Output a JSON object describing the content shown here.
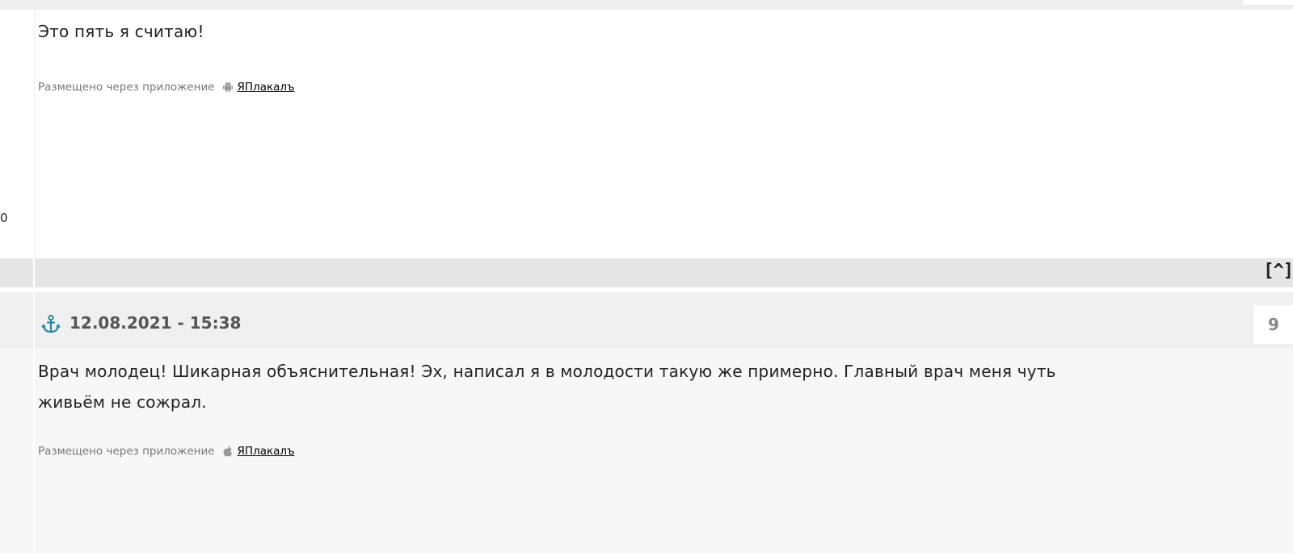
{
  "post1": {
    "message": "Это пять я считаю!",
    "posted_via_text": "Размещено через приложение",
    "platform_icon": "android-icon",
    "app_link": "ЯПлакалъ",
    "rating": "0"
  },
  "separator": {
    "up_link": "[^]"
  },
  "post2": {
    "anchor_icon": "anchor-icon",
    "date": "12.08.2021 - 15:38",
    "number": "9",
    "message_line1": "Врач молодец! Шикарная объяснительная! Эх, написал я в молодости такую же примерно. Главный врач меня чуть",
    "message_line2": "живьём не сожрал.",
    "posted_via_text": "Размещено через приложение",
    "platform_icon": "apple-icon",
    "app_link": "ЯПлакалъ"
  },
  "colors": {
    "anchor": "#2a8aa0",
    "separator_bg": "#e6e6e6",
    "header_bg": "#f0f0f0",
    "body2_bg": "#f7f7f7"
  }
}
